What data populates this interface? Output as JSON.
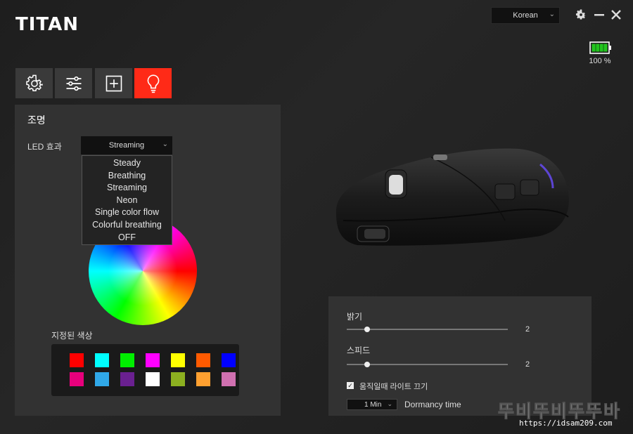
{
  "app": {
    "logo": "TITAN"
  },
  "header": {
    "language": "Korean",
    "battery_text": "100 %",
    "battery_level": 1.0
  },
  "tabs": [
    {
      "icon": "gear-icon",
      "active": false
    },
    {
      "icon": "sliders-icon",
      "active": false
    },
    {
      "icon": "plus-square-icon",
      "active": false
    },
    {
      "icon": "lightbulb-icon",
      "active": true
    }
  ],
  "lighting": {
    "title": "조명",
    "led_label": "LED 효과",
    "led_selected": "Streaming",
    "led_options": [
      "Steady",
      "Breathing",
      "Streaming",
      "Neon",
      "Single color flow",
      "Colorful breathing",
      "OFF"
    ],
    "preset_label": "지정된 색상",
    "preset_colors": [
      "#ff0000",
      "#00ffff",
      "#00ee00",
      "#ff00ff",
      "#ffff00",
      "#ff5a00",
      "#0000ff",
      "#e8007c",
      "#30a8e8",
      "#6a2090",
      "#ffffff",
      "#8cb020",
      "#ffa030",
      "#d070b0"
    ]
  },
  "settings": {
    "brightness_label": "밝기",
    "brightness_value": "2",
    "brightness_level": 0.125,
    "speed_label": "스피드",
    "speed_value": "2",
    "speed_level": 0.125,
    "motion_light_label": "움직일때 라이트 끄기",
    "motion_light_checked": true,
    "dormancy_value": "1 Min",
    "dormancy_label": "Dormancy time"
  },
  "watermark": {
    "title": "뚜비뚜비뚜뚜바",
    "url": "https://idsam209.com"
  }
}
